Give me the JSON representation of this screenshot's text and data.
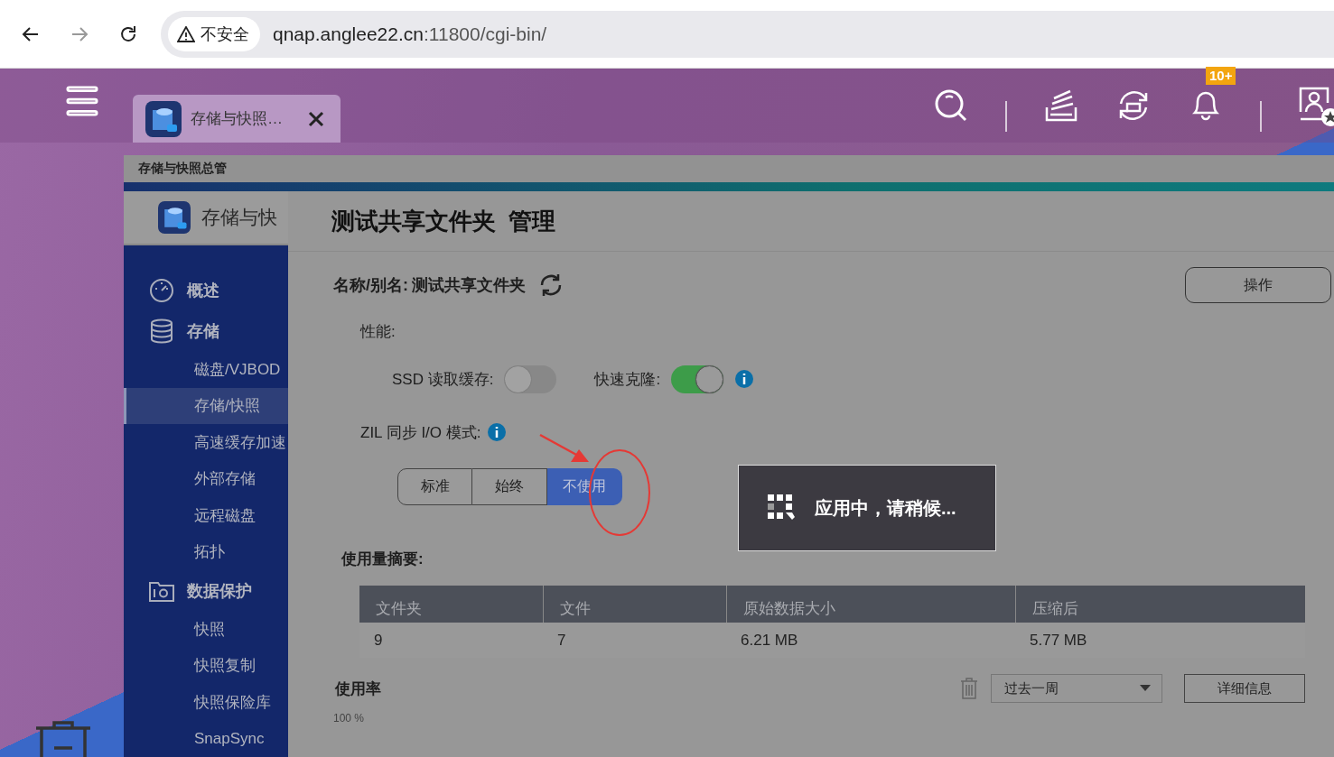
{
  "browser": {
    "security_label": "不安全",
    "url": {
      "host": "qnap.anglee22.cn",
      "path": ":11800/cgi-bin/"
    }
  },
  "header": {
    "tab": {
      "title": "存储与快照…"
    },
    "notification_badge": "10+"
  },
  "window": {
    "title": "存储与快照总管",
    "app_name": "存储与快",
    "sidebar": {
      "items": [
        {
          "label": "概述",
          "selected": false
        },
        {
          "label": "存储",
          "selected": false,
          "children": [
            {
              "label": "磁盘/VJBOD",
              "selected": false
            },
            {
              "label": "存储/快照",
              "selected": true
            },
            {
              "label": "高速缓存加速",
              "selected": false
            },
            {
              "label": "外部存储",
              "selected": false
            },
            {
              "label": "远程磁盘",
              "selected": false
            },
            {
              "label": "拓扑",
              "selected": false
            }
          ]
        },
        {
          "label": "数据保护",
          "selected": false,
          "children": [
            {
              "label": "快照",
              "selected": false
            },
            {
              "label": "快照复制",
              "selected": false
            },
            {
              "label": "快照保险库",
              "selected": false
            },
            {
              "label": "SnapSync",
              "selected": false
            }
          ]
        }
      ]
    },
    "main": {
      "heading": "测试共享文件夹  管理",
      "name_label": "名称/别名:",
      "name_value": "测试共享文件夹",
      "action_button": "操作",
      "performance_label": "性能:",
      "toggles": [
        {
          "label": "SSD 读取缓存:",
          "on": false
        },
        {
          "label": "快速克隆:",
          "on": true
        }
      ],
      "zil_label": "ZIL 同步 I/O 模式:",
      "zil_modes": [
        {
          "label": "标准",
          "selected": false
        },
        {
          "label": "始终",
          "selected": false
        },
        {
          "label": "不使用",
          "selected": true
        }
      ],
      "usage_summary": {
        "title": "使用量摘要:",
        "columns": [
          "文件夹",
          "文件",
          "原始数据大小",
          "压缩后"
        ],
        "rows": [
          [
            "9",
            "7",
            "6.21 MB",
            "5.77 MB"
          ]
        ]
      },
      "usage_rate": {
        "title": "使用率",
        "period": "过去一周",
        "details_button": "详细信息",
        "axis_label": "100 %"
      }
    }
  },
  "toast": {
    "message": "应用中，请稍候..."
  }
}
